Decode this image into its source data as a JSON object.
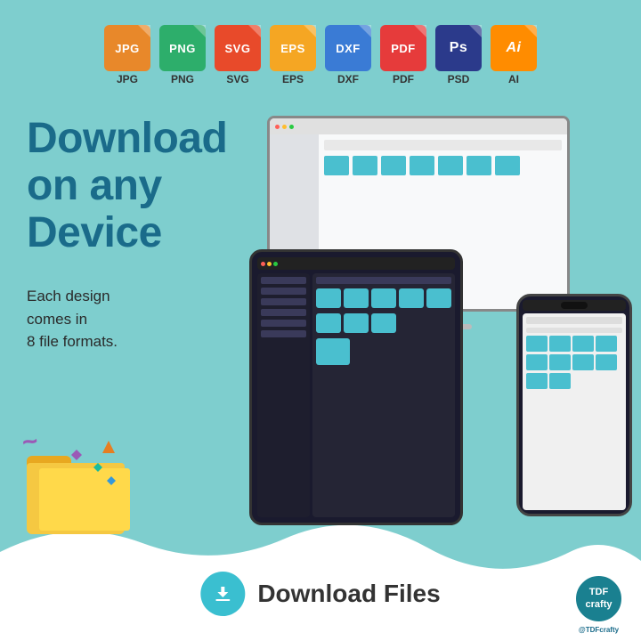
{
  "page": {
    "background_color": "#7ECECE",
    "title": "Download on any Device"
  },
  "file_icons": [
    {
      "id": "jpg",
      "type_label": "JPG",
      "ext_label": "JPG",
      "color_class": "jpg-color",
      "color": "#E8882A"
    },
    {
      "id": "png",
      "type_label": "PNG",
      "ext_label": "PNG",
      "color_class": "png-color",
      "color": "#2DAE6B"
    },
    {
      "id": "svg",
      "type_label": "SVG",
      "ext_label": "SVG",
      "color_class": "svg-color",
      "color": "#E84A2A"
    },
    {
      "id": "eps",
      "type_label": "EPS",
      "ext_label": "EPS",
      "color_class": "eps-color",
      "color": "#F5A623"
    },
    {
      "id": "dxf",
      "type_label": "DXF",
      "ext_label": "DXF",
      "color_class": "dxf-color",
      "color": "#3A7BD5"
    },
    {
      "id": "pdf",
      "type_label": "PDF",
      "ext_label": "PDF",
      "color_class": "pdf-color",
      "color": "#E63B3B"
    },
    {
      "id": "psd",
      "type_label": "Ps",
      "ext_label": "PSD",
      "color_class": "psd-color",
      "color": "#2B3A8B"
    },
    {
      "id": "ai",
      "type_label": "Ai",
      "ext_label": "AI",
      "color_class": "ai-color",
      "color": "#FF8C00"
    }
  ],
  "heading": {
    "line1": "Download",
    "line2": "on any",
    "line3": "Device"
  },
  "subtext": "Each design\ncomes in\n8 file formats.",
  "download_button": {
    "label": "Download Files"
  },
  "brand": {
    "name": "TDFcrafty",
    "handle": "@TDFcrafty"
  }
}
